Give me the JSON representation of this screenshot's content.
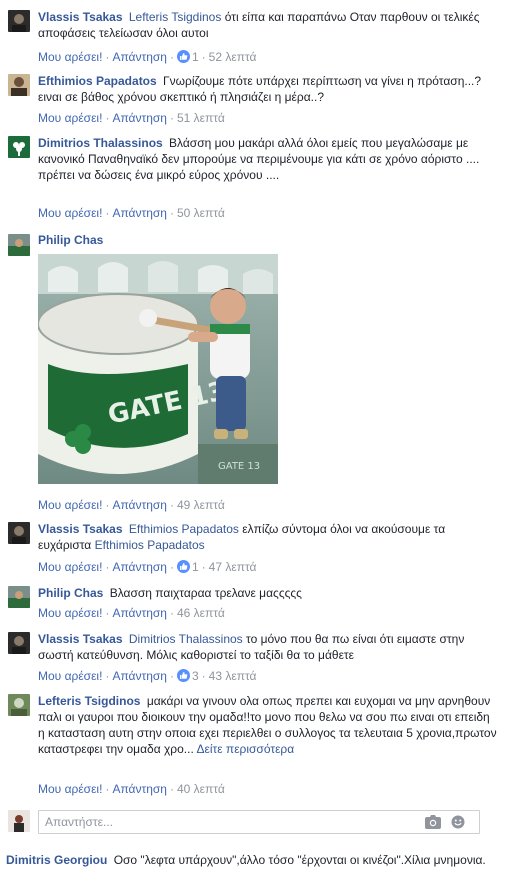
{
  "actions": {
    "like": "Μου αρέσει!",
    "reply": "Απάντηση",
    "separator": "·"
  },
  "comments": [
    {
      "author": "Vlassis Tsakas",
      "mention": "Lefteris Tsigdinos",
      "text": "ότι είπα και παραπάνω Οταν παρθουν οι τελικές αποφάσεις τελείωσαν όλοι αυτοι",
      "reactions": "1",
      "time": "52 λεπτά"
    },
    {
      "author": "Efthimios Papadatos",
      "text": "Γνωρίζουμε πότε υπάρχει περίπτωση να γίνει η πρόταση...?ειναι σε βάθος χρόνου σκεπτικό ή πλησιάζει η μέρα..?",
      "time": "51 λεπτά"
    },
    {
      "author": "Dimitrios Thalassinos",
      "text": "Βλάσση μου μακάρι αλλά όλοι εμείς που μεγαλώσαμε με κανονικό Παναθηναϊκό δεν μπορούμε να περιμένουμε για κάτι σε χρόνο αόριστο .... πρέπει να δώσεις ένα μικρό εύρος χρόνου ....",
      "time": "50 λεπτά"
    },
    {
      "author": "Philip Chas",
      "photo_label": "GATE 13",
      "time": "49 λεπτά"
    },
    {
      "author": "Vlassis Tsakas",
      "mention": "Efthimios Papadatos",
      "text": "ελπίζω σύντομα όλοι να ακούσουμε τα ευχάριστα",
      "mention2": "Efthimios Papadatos",
      "reactions": "1",
      "time": "47 λεπτά"
    },
    {
      "author": "Philip Chas",
      "text": "Βλασση παιχταραα τρελανε μαςςςςς",
      "time": "46 λεπτά"
    },
    {
      "author": "Vlassis Tsakas",
      "mention": "Dimitrios Thalassinos",
      "text": "το μόνο που θα πω είναι ότι ειμαστε στην σωστή κατεύθυνση. Μόλις καθοριστεί το ταξίδι θα το μάθετε",
      "reactions": "3",
      "time": "43 λεπτά"
    },
    {
      "author": "Lefteris Tsigdinos",
      "text": "μακάρι να γινουν ολα οπως πρεπει και ευχομαι να μην αρνηθουν παλι οι γαυροι που διοικουν την ομαδα!!το μονο που θελω να σου πω ειναι οτι επειδη η κατασταση αυτη στην οποια εχει περιελθει ο συλλογος τα τελευταια 5 χρονια,πρωτον καταστρεφει την ομαδα χρο...",
      "see_more": "Δείτε περισσότερα",
      "time": "40 λεπτά"
    }
  ],
  "reply_box": {
    "placeholder": "Απαντήστε..."
  },
  "bottom_comment": {
    "author": "Dimitris Georgiou",
    "text": "Οσο \"λεφτα υπάρχουν\",άλλο τόσο \"έρχονται οι κινέζοι\".Χίλια μνημονια."
  },
  "colors": {
    "link": "#365899",
    "action_link": "#4267b2",
    "meta": "#90949c",
    "text": "#1d2129",
    "like_blue": "#5890ff"
  }
}
